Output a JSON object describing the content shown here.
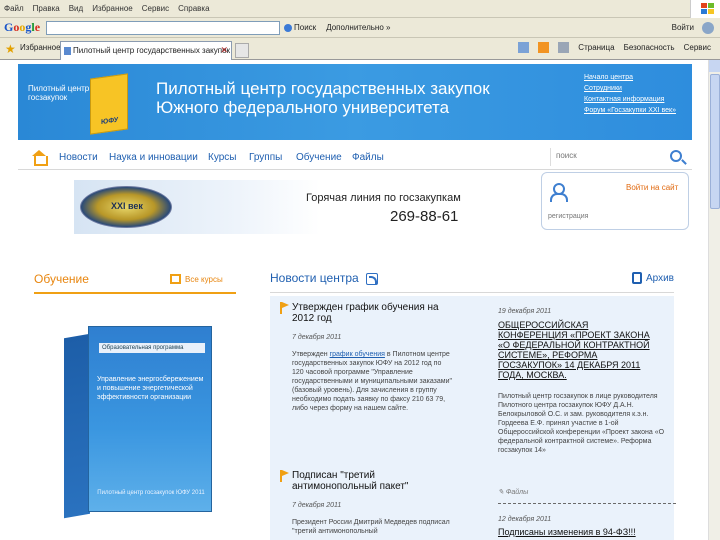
{
  "browser": {
    "menu": [
      "Файл",
      "Правка",
      "Вид",
      "Избранное",
      "Сервис",
      "Справка"
    ],
    "google_logo": [
      "G",
      "o",
      "o",
      "g",
      "l",
      "e"
    ],
    "search_button": "Поиск",
    "extra_button": "Дополнительно »",
    "signin": "Войти",
    "favorites": "Избранное",
    "tab_title": "Пилотный центр государственных закупок",
    "tools": [
      "Страница",
      "Безопасность",
      "Сервис"
    ]
  },
  "banner": {
    "logo_text": "Пилотный центр госзакупок",
    "logo_label": "ЮФУ",
    "title_line1": "Пилотный центр государственных закупок",
    "title_line2": "Южного федерального университета",
    "links": [
      "Начало центра",
      "Сотрудники",
      "Контактная информация",
      "Форум «Госзакупки XXI век»"
    ]
  },
  "nav": {
    "items": [
      "Новости",
      "Наука и инновации",
      "Курсы",
      "Группы",
      "Обучение",
      "Файлы"
    ],
    "search_placeholder": "поиск"
  },
  "hotline": {
    "emblem_text": "XXI век",
    "title": "Горячая линия по госзакупкам",
    "phone": "269-88-61"
  },
  "login": {
    "login_link": "Войти на сайт",
    "register_link": "регистрация"
  },
  "education": {
    "title": "Обучение",
    "all_courses": "Все курсы",
    "box_header": "Образовательная программа",
    "box_text": "Управление энергосбережением и повышение энергетической эффективности организации",
    "box_footer": "Пилотный центр госзакупок ЮФУ 2011"
  },
  "news": {
    "title": "Новости центра",
    "archive": "Архив",
    "items": [
      {
        "title": "Утвержден график обучения на 2012 год",
        "date": "7 декабря 2011",
        "body_before": "Утвержден",
        "body_link": "график обучения",
        "body_after": "в Пилотном центре государственных закупок ЮФУ на 2012 год по 120 часовой программе \"Управление государственными и муниципальными заказами\"(базовый уровень). Для зачисления в группу необходимо подать заявку по факсу 210 63 79, либо через форму на нашем сайте."
      },
      {
        "title": "Подписан \"третий антимонопольный пакет\"",
        "date": "7 декабря 2011",
        "body": "Президент России Дмитрий Медведев подписал \"третий антимонопольный"
      }
    ],
    "right_items": [
      {
        "date": "19 декабря 2011",
        "title": "ОБЩЕРОССИЙСКАЯ КОНФЕРЕНЦИЯ «ПРОЕКТ ЗАКОНА «О ФЕДЕРАЛЬНОЙ КОНТРАКТНОЙ СИСТЕМЕ», РЕФОРМА ГОСЗАКУПОК» 14 ДЕКАБРЯ 2011 ГОДА, МОСКВА.",
        "body": "Пилотный центр госзакупок в лице руководителя Пилотного центра госзакупок ЮФУ Д.А.Н. Белокрыловой О.С. и зам. руководителя к.э.н. Гордеева Е.Ф. принял участие в 1-ой Общероссийской конференции «Проект закона «О федеральной контрактной системе». Реформа госзакупок 14»",
        "files": "Файлы"
      },
      {
        "date": "12 декабря 2011",
        "title": "Подписаны изменения в 94-ФЗ!!!"
      }
    ]
  }
}
